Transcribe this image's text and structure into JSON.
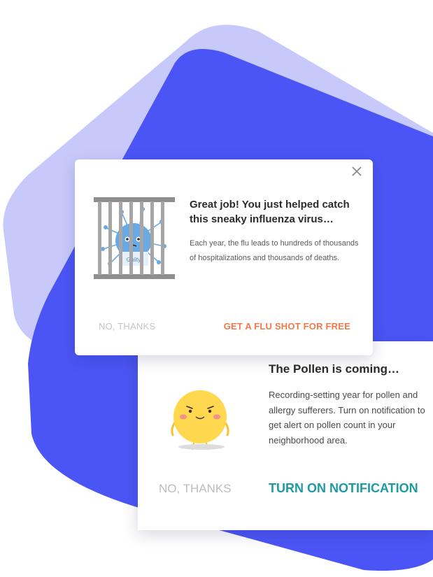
{
  "background": {
    "light_shape_color": "#c8c9fb",
    "dark_shape_color": "#4b55f5"
  },
  "flu_card": {
    "title": "Great job! You just helped catch this sneaky influenza virus…",
    "body": "Each year, the flu leads to hundreds of thousands of hospitalizations and thousands of deaths.",
    "illustration_label": "Guilty",
    "dismiss_label": "NO, THANKS",
    "cta_label": "GET A FLU SHOT FOR FREE",
    "close_icon": "close-icon",
    "cta_color": "#f07849"
  },
  "pollen_card": {
    "title": "The Pollen is coming…",
    "body": "Recording-setting year for pollen and allergy sufferers. Turn on notification to get alert on pollen count in your neighborhood area.",
    "dismiss_label": "NO, THANKS",
    "cta_label": "TURN ON NOTIFICATION",
    "cta_color": "#1f9aa3"
  }
}
